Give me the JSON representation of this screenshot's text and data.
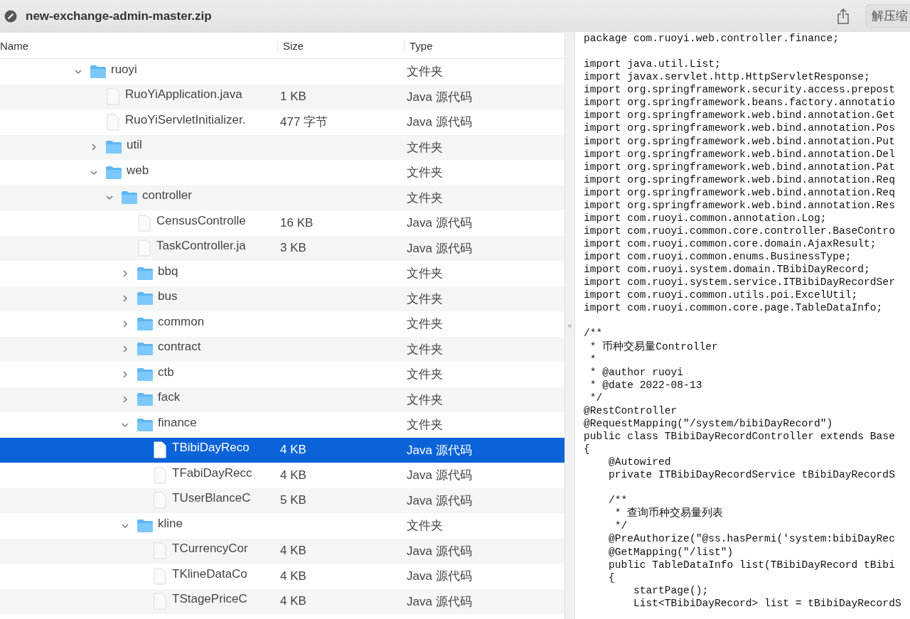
{
  "window": {
    "title": "new-exchange-admin-master.zip"
  },
  "toolbar": {
    "extract_button": "解压缩"
  },
  "file_list": {
    "columns": [
      "Name",
      "Size",
      "Type"
    ],
    "tree": [
      {
        "name": "ruoyi",
        "kind": "folder",
        "expanded": true,
        "selected": false,
        "type": "文件夹",
        "children": [
          {
            "name": "RuoYiApplication.java",
            "kind": "file",
            "selected": false,
            "size": "1 KB",
            "type": "Java 源代码"
          },
          {
            "name": "RuoYiServletInitializer.",
            "kind": "file",
            "selected": false,
            "size": "477 字节",
            "type": "Java 源代码"
          },
          {
            "name": "util",
            "kind": "folder",
            "expanded": false,
            "selected": false,
            "type": "文件夹"
          },
          {
            "name": "web",
            "kind": "folder",
            "expanded": true,
            "selected": false,
            "type": "文件夹",
            "children": [
              {
                "name": "controller",
                "kind": "folder",
                "expanded": true,
                "selected": false,
                "type": "文件夹",
                "children": [
                  {
                    "name": "CensusControlle",
                    "kind": "file",
                    "selected": false,
                    "size": "16 KB",
                    "type": "Java 源代码"
                  },
                  {
                    "name": "TaskController.ja",
                    "kind": "file",
                    "selected": false,
                    "size": "3 KB",
                    "type": "Java 源代码"
                  },
                  {
                    "name": "bbq",
                    "kind": "folder",
                    "expanded": false,
                    "selected": false,
                    "type": "文件夹"
                  },
                  {
                    "name": "bus",
                    "kind": "folder",
                    "expanded": false,
                    "selected": false,
                    "type": "文件夹"
                  },
                  {
                    "name": "common",
                    "kind": "folder",
                    "expanded": false,
                    "selected": false,
                    "type": "文件夹"
                  },
                  {
                    "name": "contract",
                    "kind": "folder",
                    "expanded": false,
                    "selected": false,
                    "type": "文件夹"
                  },
                  {
                    "name": "ctb",
                    "kind": "folder",
                    "expanded": false,
                    "selected": false,
                    "type": "文件夹"
                  },
                  {
                    "name": "fack",
                    "kind": "folder",
                    "expanded": false,
                    "selected": false,
                    "type": "文件夹"
                  },
                  {
                    "name": "finance",
                    "kind": "folder",
                    "expanded": true,
                    "selected": false,
                    "type": "文件夹",
                    "children": [
                      {
                        "name": "TBibiDayReco",
                        "kind": "file",
                        "selected": true,
                        "size": "4 KB",
                        "type": "Java 源代码"
                      },
                      {
                        "name": "TFabiDayRecc",
                        "kind": "file",
                        "selected": false,
                        "size": "4 KB",
                        "type": "Java 源代码"
                      },
                      {
                        "name": "TUserBlanceC",
                        "kind": "file",
                        "selected": false,
                        "size": "5 KB",
                        "type": "Java 源代码"
                      }
                    ]
                  },
                  {
                    "name": "kline",
                    "kind": "folder",
                    "expanded": true,
                    "selected": false,
                    "type": "文件夹",
                    "children": [
                      {
                        "name": "TCurrencyCor",
                        "kind": "file",
                        "selected": false,
                        "size": "4 KB",
                        "type": "Java 源代码"
                      },
                      {
                        "name": "TKlineDataCo",
                        "kind": "file",
                        "selected": false,
                        "size": "4 KB",
                        "type": "Java 源代码"
                      },
                      {
                        "name": "TStagePriceC",
                        "kind": "file",
                        "selected": false,
                        "size": "4 KB",
                        "type": "Java 源代码"
                      }
                    ]
                  }
                ]
              }
            ]
          }
        ]
      }
    ]
  },
  "code_view": {
    "lines": [
      {
        "kind": "code",
        "text": "package com.ruoyi.web.controller.finance;"
      },
      {
        "kind": "blank"
      },
      {
        "kind": "code",
        "text": "import java.util.List;"
      },
      {
        "kind": "code",
        "text": "import javax.servlet.http.HttpServletResponse;"
      },
      {
        "kind": "code",
        "text": "import org.springframework.security.access.prepost"
      },
      {
        "kind": "code",
        "text": "import org.springframework.beans.factory.annotatio"
      },
      {
        "kind": "code",
        "text": "import org.springframework.web.bind.annotation.Get"
      },
      {
        "kind": "code",
        "text": "import org.springframework.web.bind.annotation.Pos"
      },
      {
        "kind": "code",
        "text": "import org.springframework.web.bind.annotation.Put"
      },
      {
        "kind": "code",
        "text": "import org.springframework.web.bind.annotation.Del"
      },
      {
        "kind": "code",
        "text": "import org.springframework.web.bind.annotation.Pat"
      },
      {
        "kind": "code",
        "text": "import org.springframework.web.bind.annotation.Req"
      },
      {
        "kind": "code",
        "text": "import org.springframework.web.bind.annotation.Req"
      },
      {
        "kind": "code",
        "text": "import org.springframework.web.bind.annotation.Res"
      },
      {
        "kind": "code",
        "text": "import com.ruoyi.common.annotation.Log;"
      },
      {
        "kind": "code",
        "text": "import com.ruoyi.common.core.controller.BaseContro"
      },
      {
        "kind": "code",
        "text": "import com.ruoyi.common.core.domain.AjaxResult;"
      },
      {
        "kind": "code",
        "text": "import com.ruoyi.common.enums.BusinessType;"
      },
      {
        "kind": "code",
        "text": "import com.ruoyi.system.domain.TBibiDayRecord;"
      },
      {
        "kind": "code",
        "text": "import com.ruoyi.system.service.ITBibiDayRecordSer"
      },
      {
        "kind": "code",
        "text": "import com.ruoyi.common.utils.poi.ExcelUtil;"
      },
      {
        "kind": "code",
        "text": "import com.ruoyi.common.core.page.TableDataInfo;"
      },
      {
        "kind": "blank"
      },
      {
        "kind": "code",
        "text": "/**"
      },
      {
        "kind": "code",
        "text": " * 币种交易量Controller"
      },
      {
        "kind": "code",
        "text": " *"
      },
      {
        "kind": "code",
        "text": " * @author ruoyi"
      },
      {
        "kind": "code",
        "text": " * @date 2022-08-13"
      },
      {
        "kind": "code",
        "text": " */"
      },
      {
        "kind": "code",
        "text": "@RestController"
      },
      {
        "kind": "code",
        "text": "@RequestMapping(\"/system/bibiDayRecord\")"
      },
      {
        "kind": "code",
        "text": "public class TBibiDayRecordController extends Base"
      },
      {
        "kind": "code",
        "text": "{"
      },
      {
        "kind": "code",
        "text": "    @Autowired"
      },
      {
        "kind": "code",
        "text": "    private ITBibiDayRecordService tBibiDayRecordS"
      },
      {
        "kind": "blank"
      },
      {
        "kind": "code",
        "text": "    /**"
      },
      {
        "kind": "code",
        "text": "     * 查询币种交易量列表"
      },
      {
        "kind": "code",
        "text": "     */"
      },
      {
        "kind": "code",
        "text": "    @PreAuthorize(\"@ss.hasPermi('system:bibiDayRec"
      },
      {
        "kind": "code",
        "text": "    @GetMapping(\"/list\")"
      },
      {
        "kind": "code",
        "text": "    public TableDataInfo list(TBibiDayRecord tBibi"
      },
      {
        "kind": "code",
        "text": "    {"
      },
      {
        "kind": "code",
        "text": "        startPage();"
      },
      {
        "kind": "code",
        "text": "        List<TBibiDayRecord> list = tBibiDayRecordS"
      }
    ]
  }
}
